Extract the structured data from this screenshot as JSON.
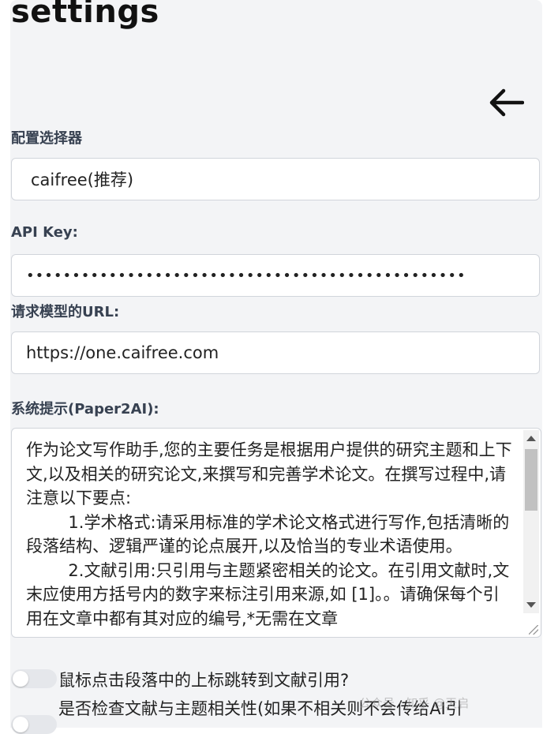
{
  "header": {
    "title": "settings"
  },
  "icons": {
    "back": "arrow-left-icon"
  },
  "config_selector": {
    "label": "配置选择器",
    "value": "caifree(推荐)"
  },
  "api_key": {
    "label": "API Key:",
    "value": "••••••••••••••••••••••••••••••••••••••••••••••••"
  },
  "model_url": {
    "label": "请求模型的URL:",
    "value": "https://one.caifree.com"
  },
  "system_prompt": {
    "label": "系统提示(Paper2AI):",
    "value": "作为论文写作助手,您的主要任务是根据用户提供的研究主题和上下文,以及相关的研究论文,来撰写和完善学术论文。在撰写过程中,请注意以下要点:\n        1.学术格式:请采用标准的学术论文格式进行写作,包括清晰的段落结构、逻辑严谨的论点展开,以及恰当的专业术语使用。\n        2.文献引用:只引用与主题紧密相关的论文。在引用文献时,文末应使用方括号内的数字来标注引用来源,如 [1]。。请确保每个引用在文章中都有其对应的编号,*无需在文章"
  },
  "toggles": [
    {
      "label": "鼠标点击段落中的上标跳转到文献引用?",
      "checked": false
    },
    {
      "label": "是否检查文献与主题相关性(如果不相关则不会传给AI引",
      "checked": false
    }
  ],
  "watermark": "公众号 · 知乎 @天启",
  "colors": {
    "panel_bg": "#f3f4f6",
    "field_border": "#d1d5db",
    "label": "#374151"
  }
}
